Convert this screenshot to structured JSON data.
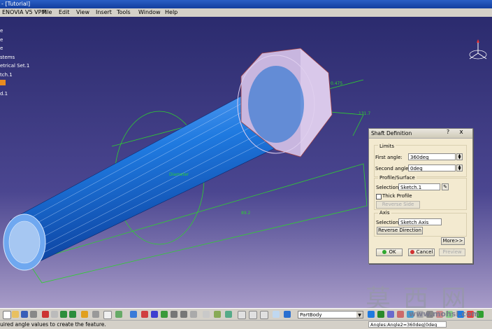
{
  "window": {
    "title": "- [Tutorial]"
  },
  "menu": [
    "ENOVIA V5 VPM",
    "File",
    "Edit",
    "View",
    "Insert",
    "Tools",
    "Window",
    "Help"
  ],
  "tree": [
    "e",
    "e",
    "e",
    "stems",
    "etrical Set.1",
    "tch.1",
    "",
    "d.1"
  ],
  "dimensions": [
    "0.475",
    "131.7",
    "Diameter",
    "89.2"
  ],
  "dialog": {
    "title": "Shaft Definition",
    "help": "?",
    "close": "x",
    "limits_label": "Limits",
    "first_angle_label": "First angle:",
    "first_angle_value": "360deg",
    "second_angle_label": "Second angle:",
    "second_angle_value": "0deg",
    "profile_label": "Profile/Surface",
    "profile_selection_label": "Selection:",
    "profile_selection_value": "Sketch.1",
    "thick_profile_label": "Thick Profile",
    "reverse_side_label": "Reverse Side",
    "axis_label": "Axis",
    "axis_selection_label": "Selection:",
    "axis_selection_value": "Sketch Axis",
    "reverse_direction_label": "Reverse Direction",
    "more_label": "More>>",
    "ok_label": "OK",
    "cancel_label": "Cancel",
    "preview_label": "Preview"
  },
  "toolbar": {
    "part_body": "PartBody"
  },
  "status": {
    "message": "uired angle values to create the feature.",
    "command": "Angles:Angle2=360deg|0deg"
  },
  "watermark": {
    "chars": "莫西网",
    "site": "www.mohsi.com"
  },
  "colors": {
    "shaft": "#1f7ae0",
    "sketch": "#2fd02f",
    "dialog_bg": "#f3ead0",
    "title_bar": "#1a4fb8"
  }
}
